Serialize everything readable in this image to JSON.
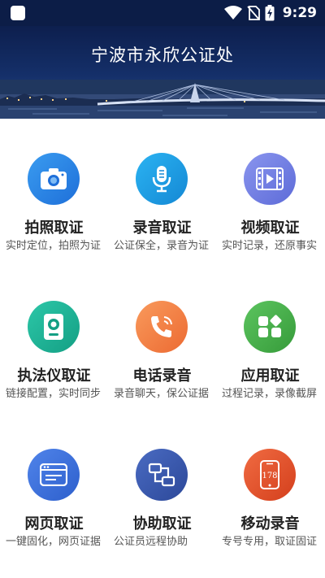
{
  "status_bar": {
    "time": "9:29"
  },
  "header": {
    "title": "宁波市永欣公证处"
  },
  "features": [
    {
      "title": "拍照取证",
      "desc": "实时定位，拍照为证",
      "icon": "camera-icon",
      "color": "#2e8ae6",
      "color2": "#1e6fd9"
    },
    {
      "title": "录音取证",
      "desc": "公证保全，录音为证",
      "icon": "microphone-icon",
      "color": "#1fa3e8",
      "color2": "#1488d4"
    },
    {
      "title": "视频取证",
      "desc": "实时记录，还原事实",
      "icon": "film-icon",
      "color": "#7a86e6",
      "color2": "#5d6bd8"
    },
    {
      "title": "执法仪取证",
      "desc": "链接配置，实时同步",
      "icon": "bodycam-icon",
      "color": "#22b79a",
      "color2": "#149f84"
    },
    {
      "title": "电话录音",
      "desc": "录音聊天，保公证据",
      "icon": "phone-call-icon",
      "color": "#f58a4b",
      "color2": "#ec6a32"
    },
    {
      "title": "应用取证",
      "desc": "过程记录，录像截屏",
      "icon": "apps-icon",
      "color": "#49b54c",
      "color2": "#369b3a"
    },
    {
      "title": "网页取证",
      "desc": "一键固化，网页证据",
      "icon": "browser-icon",
      "color": "#3f74e0",
      "color2": "#2d5fcc"
    },
    {
      "title": "协助取证",
      "desc": "公证员远程协助",
      "icon": "transfer-icon",
      "color": "#3b5bb0",
      "color2": "#2c4899"
    },
    {
      "title": "移动录音",
      "desc": "专号专用，取证固证",
      "icon": "mobile-178-icon",
      "color": "#e8562e",
      "color2": "#d43f1c",
      "badge": "178"
    }
  ]
}
